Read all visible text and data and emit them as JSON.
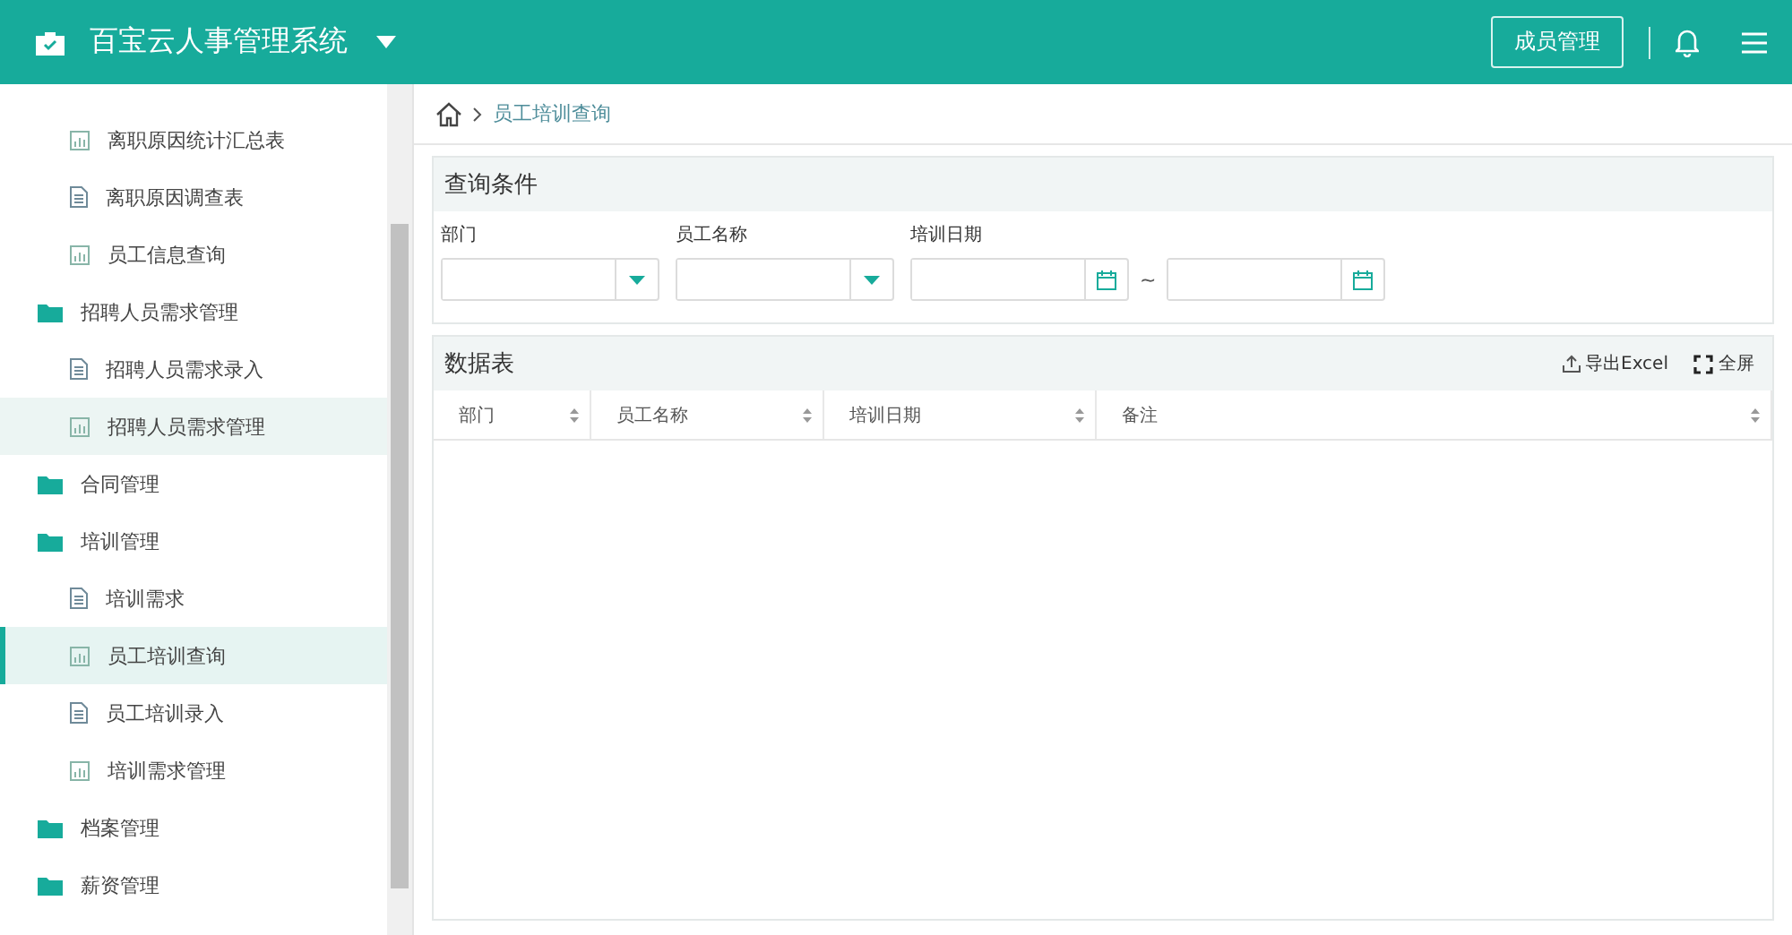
{
  "header": {
    "title": "百宝云人事管理系统",
    "member_button": "成员管理"
  },
  "sidebar": {
    "items": [
      {
        "kind": "report",
        "label": "离职原因统计汇总表",
        "selected": false,
        "hovered": false
      },
      {
        "kind": "doc",
        "label": "离职原因调查表",
        "selected": false,
        "hovered": false
      },
      {
        "kind": "report",
        "label": "员工信息查询",
        "selected": false,
        "hovered": false
      },
      {
        "kind": "folder",
        "label": "招聘人员需求管理",
        "children": [
          {
            "kind": "doc",
            "label": "招聘人员需求录入",
            "selected": false,
            "hovered": false
          },
          {
            "kind": "report",
            "label": "招聘人员需求管理",
            "selected": false,
            "hovered": true
          }
        ]
      },
      {
        "kind": "folder",
        "label": "合同管理"
      },
      {
        "kind": "folder",
        "label": "培训管理",
        "children": [
          {
            "kind": "doc",
            "label": "培训需求",
            "selected": false,
            "hovered": false
          },
          {
            "kind": "report",
            "label": "员工培训查询",
            "selected": true,
            "hovered": false
          },
          {
            "kind": "doc",
            "label": "员工培训录入",
            "selected": false,
            "hovered": false
          },
          {
            "kind": "report",
            "label": "培训需求管理",
            "selected": false,
            "hovered": false
          }
        ]
      },
      {
        "kind": "folder",
        "label": "档案管理"
      },
      {
        "kind": "folder",
        "label": "薪资管理"
      }
    ]
  },
  "breadcrumb": {
    "current": "员工培训查询"
  },
  "query": {
    "title": "查询条件",
    "fields": [
      {
        "kind": "select",
        "label": "部门"
      },
      {
        "kind": "select",
        "label": "员工名称"
      },
      {
        "kind": "daterange",
        "label": "培训日期",
        "separator": "~"
      }
    ]
  },
  "table": {
    "title": "数据表",
    "actions": [
      {
        "kind": "export",
        "label": "导出Excel"
      },
      {
        "kind": "fullscreen",
        "label": "全屏"
      }
    ],
    "columns": [
      "部门",
      "员工名称",
      "培训日期",
      "备注"
    ]
  }
}
